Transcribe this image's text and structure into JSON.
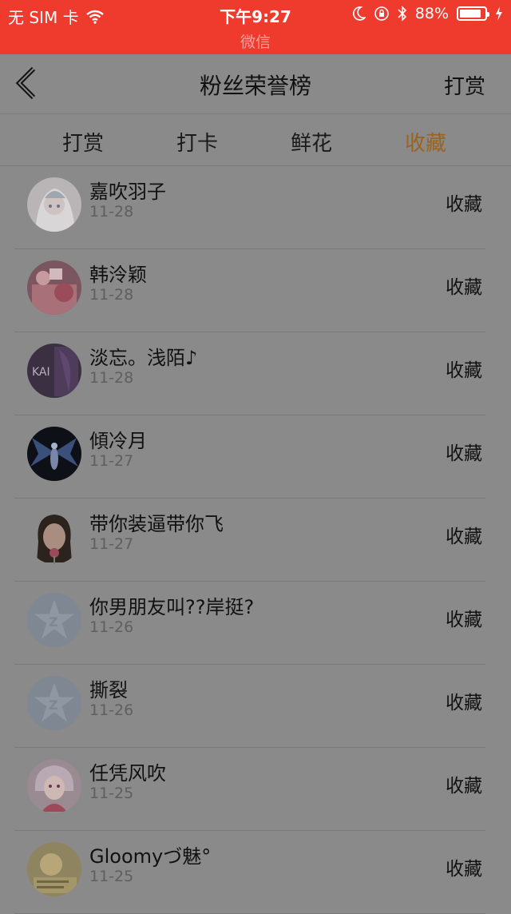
{
  "status_bar": {
    "carrier": "无 SIM 卡",
    "time": "下午9:27",
    "subtitle": "微信",
    "battery": "88%",
    "battery_level": 0.88,
    "icons": [
      "wifi-icon",
      "moon-icon",
      "orientation-lock-icon",
      "bluetooth-icon",
      "battery-icon",
      "charging-icon"
    ]
  },
  "nav": {
    "back_icon": "chevron-left-icon",
    "title": "粉丝荣誉榜",
    "right_label": "打赏"
  },
  "tabs": [
    {
      "label": "打赏",
      "active": false
    },
    {
      "label": "打卡",
      "active": false
    },
    {
      "label": "鲜花",
      "active": false
    },
    {
      "label": "收藏",
      "active": true
    }
  ],
  "colors": {
    "status_bar": "#ef3b2e",
    "overlay": "#8a8a8a",
    "active_tab": "#9a6320"
  },
  "items": [
    {
      "name": "嘉吹羽子",
      "date": "11-28",
      "action": "收藏"
    },
    {
      "name": "韩泠颖",
      "date": "11-28",
      "action": "收藏"
    },
    {
      "name": "淡忘。浅陌♪",
      "date": "11-28",
      "action": "收藏"
    },
    {
      "name": "傾冷月",
      "date": "11-27",
      "action": "收藏"
    },
    {
      "name": "带你装逼带你飞",
      "date": "11-27",
      "action": "收藏"
    },
    {
      "name": "你男朋友叫??岸挺?",
      "date": "11-26",
      "action": "收藏"
    },
    {
      "name": "撕裂",
      "date": "11-26",
      "action": "收藏"
    },
    {
      "name": "任凭风吹",
      "date": "11-25",
      "action": "收藏"
    },
    {
      "name": "Gloomyづ魅°",
      "date": "11-25",
      "action": "收藏"
    }
  ]
}
